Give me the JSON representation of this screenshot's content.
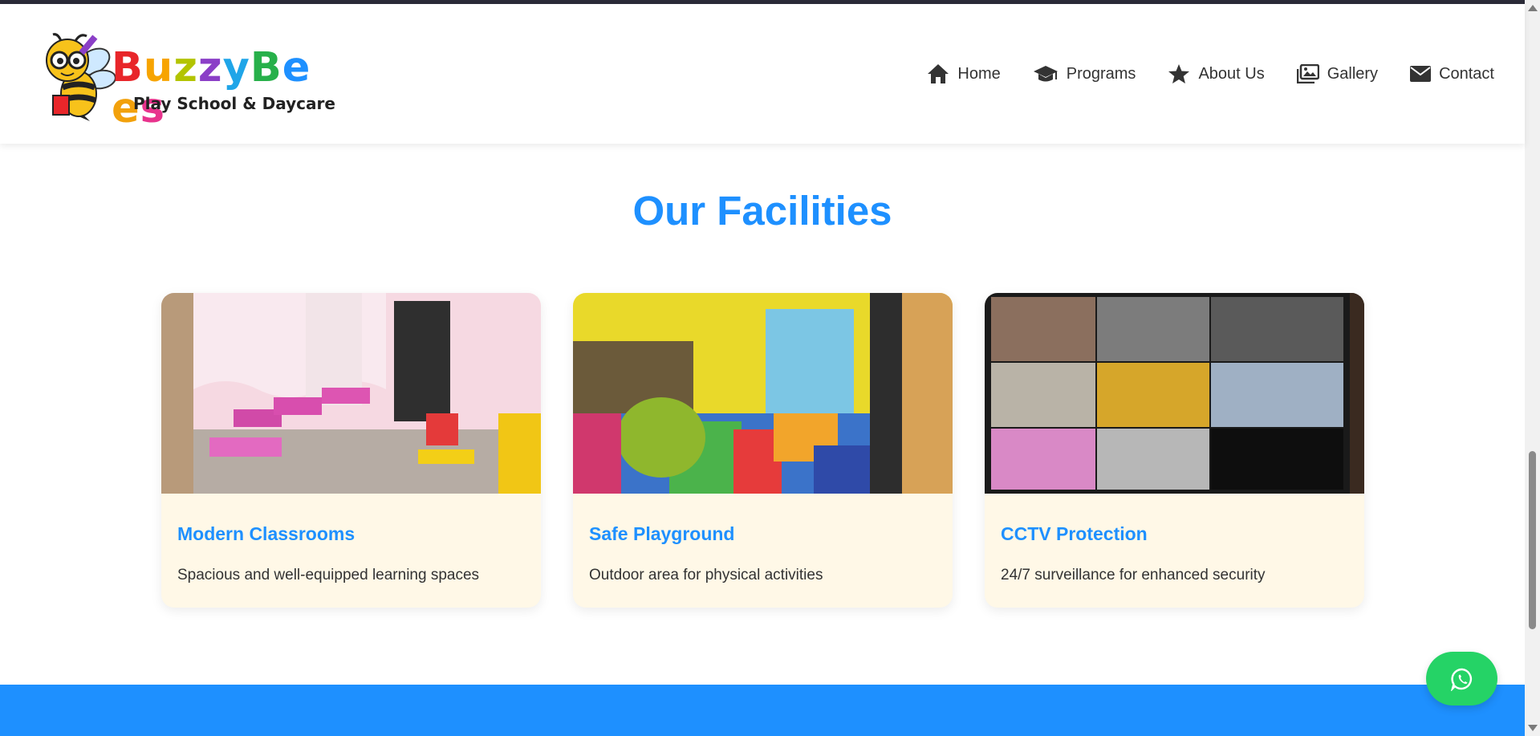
{
  "logo": {
    "letters": [
      {
        "ch": "B",
        "color": "#e8262a"
      },
      {
        "ch": "u",
        "color": "#f7a400"
      },
      {
        "ch": "z",
        "color": "#b3c400"
      },
      {
        "ch": "z",
        "color": "#8b3fc7"
      },
      {
        "ch": "y",
        "color": "#1fa5e8"
      },
      {
        "ch": "B",
        "color": "#27b04a"
      },
      {
        "ch": "e",
        "color": "#1e90ff"
      },
      {
        "ch": "e",
        "color": "#f2a10c"
      },
      {
        "ch": "s",
        "color": "#e8338d"
      }
    ],
    "tagline": "Play School & Daycare"
  },
  "nav": {
    "items": [
      {
        "label": "Home",
        "icon": "home-icon"
      },
      {
        "label": "Programs",
        "icon": "graduation-cap-icon"
      },
      {
        "label": "About Us",
        "icon": "star-icon"
      },
      {
        "label": "Gallery",
        "icon": "images-icon"
      },
      {
        "label": "Contact",
        "icon": "envelope-icon"
      }
    ]
  },
  "facilities": {
    "title": "Our Facilities",
    "cards": [
      {
        "title": "Modern Classrooms",
        "text": "Spacious and well-equipped learning spaces",
        "image": "classroom-photo"
      },
      {
        "title": "Safe Playground",
        "text": "Outdoor area for physical activities",
        "image": "playground-photo"
      },
      {
        "title": "CCTV Protection",
        "text": "24/7 surveillance for enhanced security",
        "image": "cctv-photo"
      }
    ]
  },
  "colors": {
    "accent": "#1e90ff",
    "card_bg": "#fff8e7",
    "whatsapp": "#25d366",
    "footer": "#1e90ff"
  }
}
